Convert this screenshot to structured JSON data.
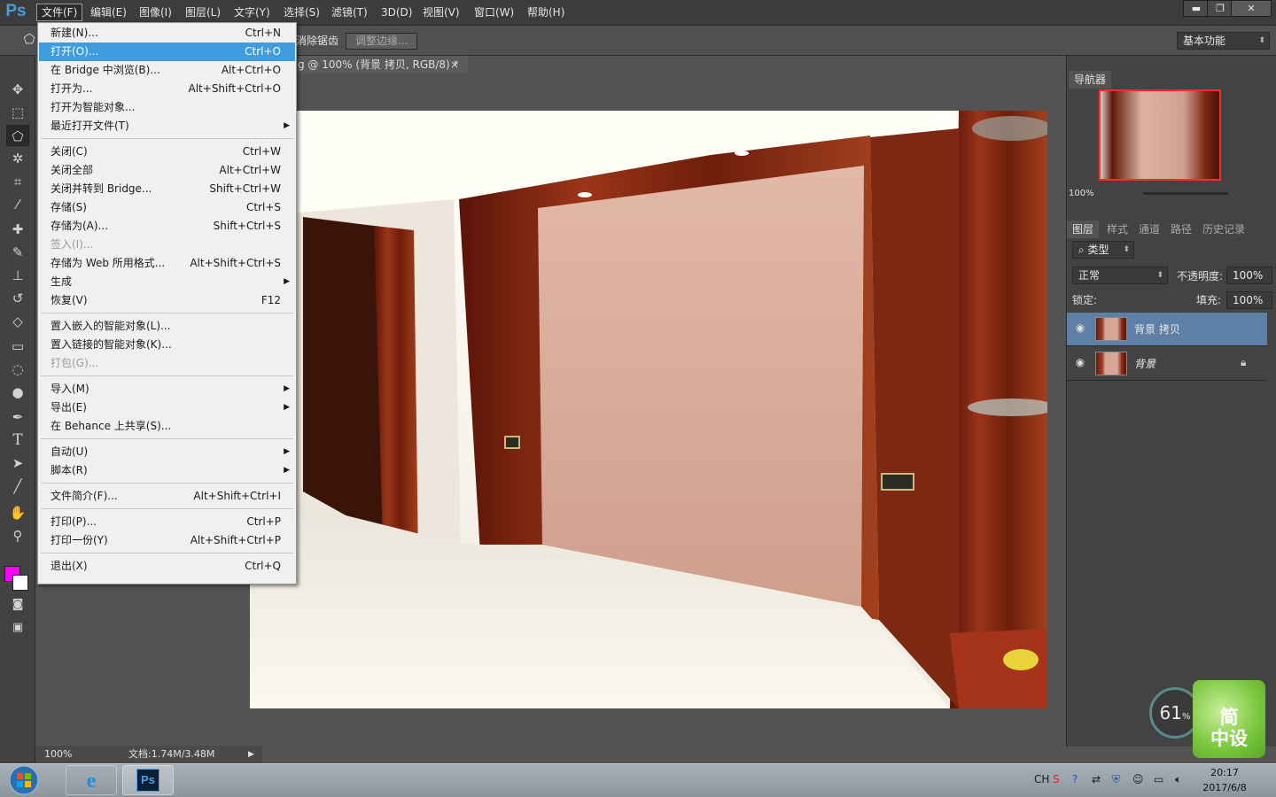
{
  "app": {
    "logo": "Ps"
  },
  "menubar": {
    "items": [
      "文件(F)",
      "编辑(E)",
      "图像(I)",
      "图层(L)",
      "文字(Y)",
      "选择(S)",
      "滤镜(T)",
      "3D(D)",
      "视图(V)",
      "窗口(W)",
      "帮助(H)"
    ],
    "active": "文件(F)"
  },
  "window_controls": {
    "minimize": "▬",
    "restore": "❐",
    "close": "✕"
  },
  "options_bar": {
    "antialias_label": "消除锯齿",
    "refine_edge_button": "调整边缘...",
    "workspace_select": "基本功能"
  },
  "document": {
    "tab_title": "g @ 100% (背景 拷贝, RGB/8) *",
    "close": "×"
  },
  "status_bar": {
    "zoom": "100%",
    "doc_size": "文档:1.74M/3.48M"
  },
  "file_menu": {
    "items": [
      {
        "label": "新建(N)...",
        "shortcut": "Ctrl+N"
      },
      {
        "label": "打开(O)...",
        "shortcut": "Ctrl+O",
        "highlighted": true
      },
      {
        "label": "在 Bridge 中浏览(B)...",
        "shortcut": "Alt+Ctrl+O"
      },
      {
        "label": "打开为...",
        "shortcut": "Alt+Shift+Ctrl+O"
      },
      {
        "label": "打开为智能对象...",
        "shortcut": ""
      },
      {
        "label": "最近打开文件(T)",
        "shortcut": "",
        "submenu": true
      },
      {
        "label": "关闭(C)",
        "shortcut": "Ctrl+W"
      },
      {
        "label": "关闭全部",
        "shortcut": "Alt+Ctrl+W"
      },
      {
        "label": "关闭并转到 Bridge...",
        "shortcut": "Shift+Ctrl+W"
      },
      {
        "label": "存储(S)",
        "shortcut": "Ctrl+S"
      },
      {
        "label": "存储为(A)...",
        "shortcut": "Shift+Ctrl+S"
      },
      {
        "label": "签入(I)...",
        "shortcut": "",
        "disabled": true
      },
      {
        "label": "存储为 Web 所用格式...",
        "shortcut": "Alt+Shift+Ctrl+S"
      },
      {
        "label": "生成",
        "shortcut": "",
        "submenu": true
      },
      {
        "label": "恢复(V)",
        "shortcut": "F12"
      },
      {
        "label": "置入嵌入的智能对象(L)...",
        "shortcut": ""
      },
      {
        "label": "置入链接的智能对象(K)...",
        "shortcut": ""
      },
      {
        "label": "打包(G)...",
        "shortcut": "",
        "disabled": true
      },
      {
        "label": "导入(M)",
        "shortcut": "",
        "submenu": true
      },
      {
        "label": "导出(E)",
        "shortcut": "",
        "submenu": true
      },
      {
        "label": "在 Behance 上共享(S)...",
        "shortcut": ""
      },
      {
        "label": "自动(U)",
        "shortcut": "",
        "submenu": true
      },
      {
        "label": "脚本(R)",
        "shortcut": "",
        "submenu": true
      },
      {
        "label": "文件简介(F)...",
        "shortcut": "Alt+Shift+Ctrl+I"
      },
      {
        "label": "打印(P)...",
        "shortcut": "Ctrl+P"
      },
      {
        "label": "打印一份(Y)",
        "shortcut": "Alt+Shift+Ctrl+P"
      },
      {
        "label": "退出(X)",
        "shortcut": "Ctrl+Q"
      }
    ]
  },
  "navigator": {
    "title": "导航器",
    "zoom": "100%"
  },
  "layers_panel": {
    "tabs": [
      "图层",
      "样式",
      "通道",
      "路径",
      "历史记录"
    ],
    "filter_kind": "类型",
    "blend_mode": "正常",
    "opacity_label": "不透明度:",
    "opacity_value": "100%",
    "lock_label": "锁定:",
    "fill_label": "填充:",
    "fill_value": "100%",
    "layers": [
      {
        "name": "背景 拷贝",
        "selected": true,
        "locked": false
      },
      {
        "name": "背景",
        "selected": false,
        "locked": true
      }
    ]
  },
  "overlay_widget": {
    "percent": "61",
    "unit": "%",
    "label_line1": "简",
    "label_line2": "中设"
  },
  "taskbar": {
    "lang": "CH",
    "time": "20:17",
    "date": "2017/6/8"
  },
  "colors": {
    "foreground": "#ff00ff",
    "background": "#ffffff",
    "menu_highlight": "#3f9ddf",
    "layer_selected": "#5e7fa6"
  },
  "icons": [
    "lasso-icon",
    "move-icon",
    "marquee-icon",
    "polygon-lasso-icon",
    "magic-wand-icon",
    "crop-icon",
    "eyedropper-icon",
    "healing-icon",
    "brush-icon",
    "stamp-icon",
    "history-brush-icon",
    "eraser-icon",
    "gradient-icon",
    "blur-icon",
    "dodge-icon",
    "pen-icon",
    "type-icon",
    "path-select-icon",
    "line-icon",
    "hand-icon",
    "zoom-icon",
    "eye-icon",
    "lock-icon"
  ]
}
